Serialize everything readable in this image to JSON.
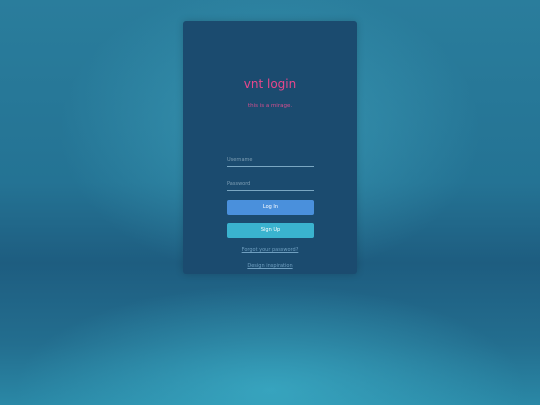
{
  "login": {
    "title": "vnt login",
    "tagline": "this is a mirage.",
    "username_placeholder": "Username",
    "password_placeholder": "Password",
    "login_label": "Log In",
    "signup_label": "Sign Up",
    "forgot_label": "Forgot your password?",
    "design_label": "Design inspiration"
  },
  "colors": {
    "card": "#1b4b6f",
    "title": "#e8478c",
    "login_button": "#4a90dc",
    "signup_button": "#3ab3cf",
    "link": "#6f9fc0"
  }
}
